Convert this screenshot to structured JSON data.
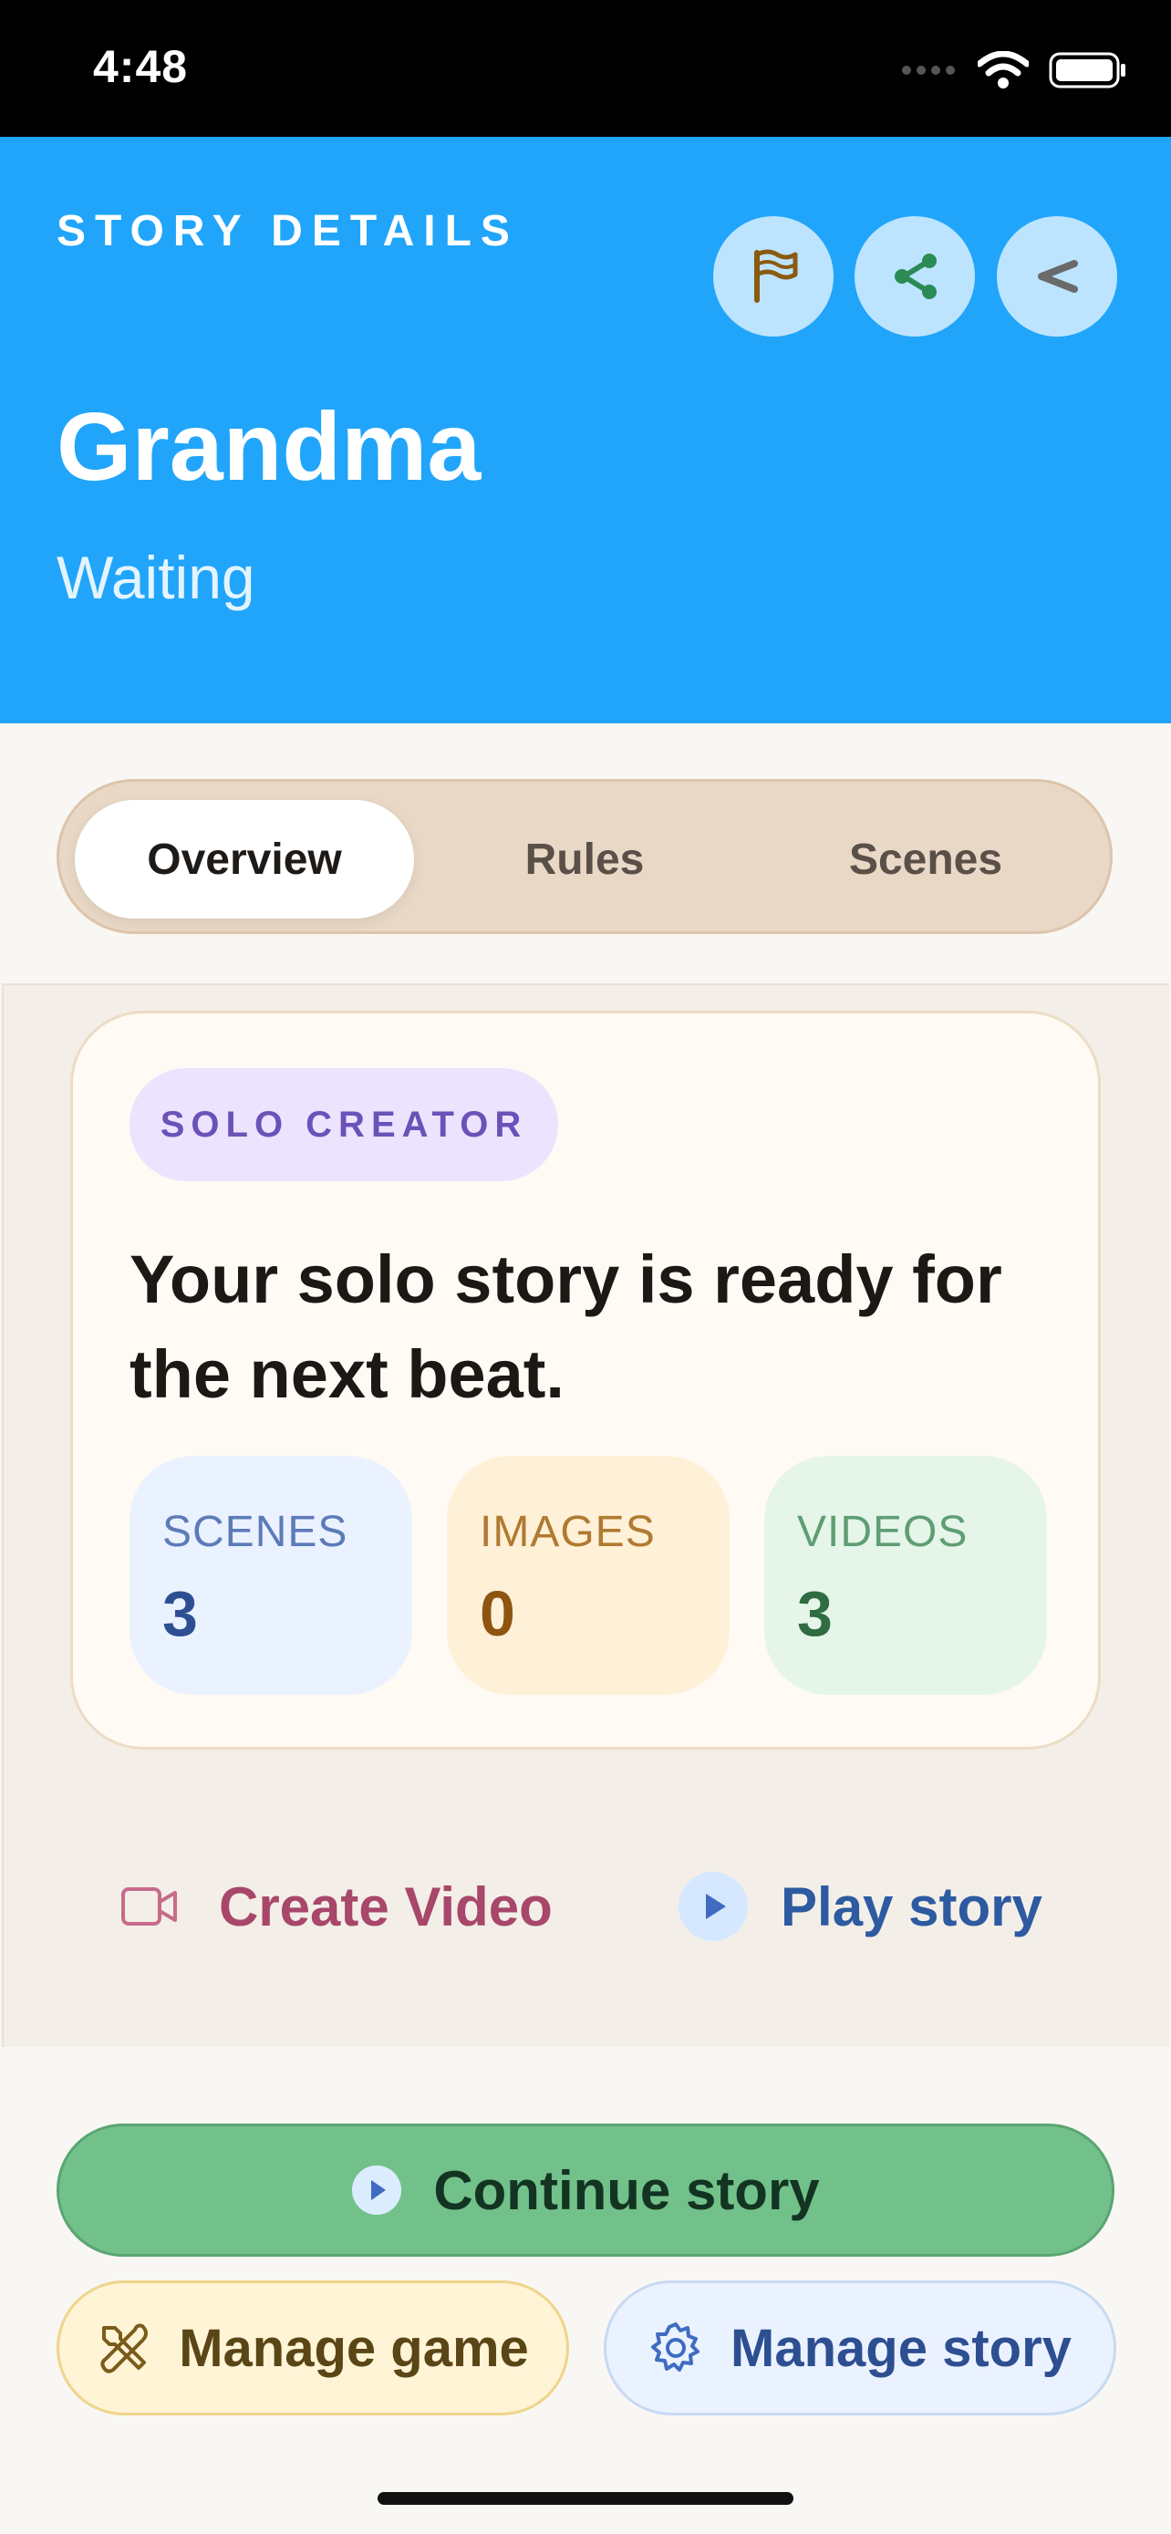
{
  "status_bar": {
    "time": "4:48"
  },
  "header": {
    "section_label": "STORY DETAILS",
    "title": "Grandma",
    "status": "Waiting",
    "buttons": {
      "flag": "flag-icon",
      "share": "share-icon",
      "back": "back-chevron-icon"
    }
  },
  "tabs": [
    {
      "label": "Overview",
      "active": true
    },
    {
      "label": "Rules",
      "active": false
    },
    {
      "label": "Scenes",
      "active": false
    }
  ],
  "card": {
    "badge": "SOLO CREATOR",
    "headline": "Your solo story is ready for the next beat.",
    "stats": [
      {
        "label": "SCENES",
        "value": "3"
      },
      {
        "label": "IMAGES",
        "value": "0"
      },
      {
        "label": "VIDEOS",
        "value": "3"
      }
    ]
  },
  "actions": {
    "create_video": "Create Video",
    "play_story": "Play story"
  },
  "buttons": {
    "continue": "Continue story",
    "manage_game": "Manage game",
    "manage_story": "Manage story"
  },
  "colors": {
    "header_bg": "#21a5fa",
    "continue_bg": "#72c18a",
    "create_video": "#a8476a",
    "play_story": "#2d5aa0"
  }
}
